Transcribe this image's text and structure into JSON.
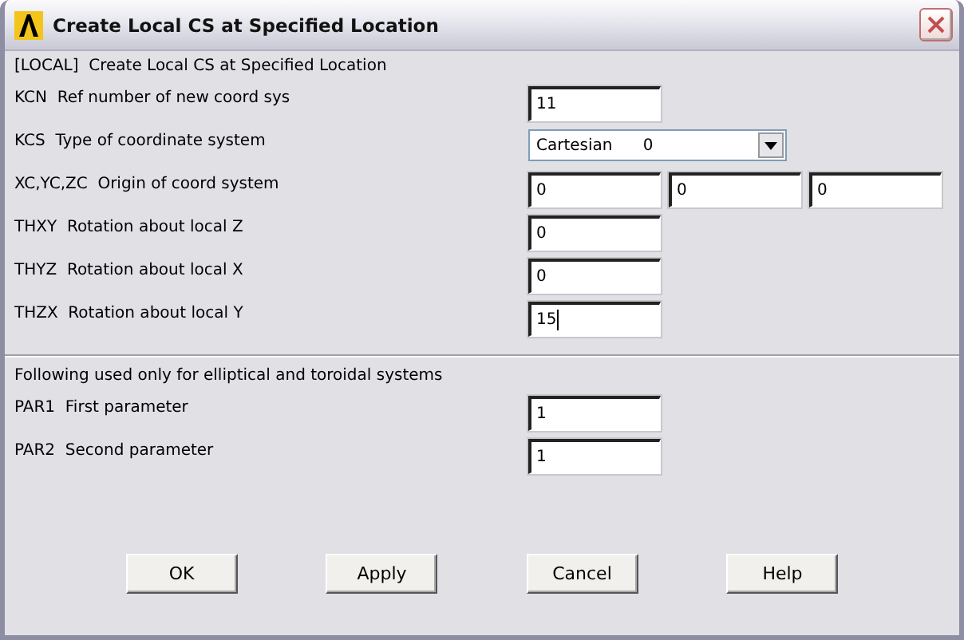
{
  "window": {
    "title": "Create Local CS at Specified Location"
  },
  "sections": [
    {
      "heading": "[LOCAL]  Create Local CS at Specified Location",
      "rows": [
        {
          "kind": "text",
          "label": "KCN  Ref number of new coord sys",
          "values": [
            "11"
          ],
          "focused": false
        },
        {
          "kind": "select",
          "label": "KCS  Type of coordinate system",
          "values": [
            "Cartesian      0"
          ]
        },
        {
          "kind": "text",
          "label": "XC,YC,ZC  Origin of coord system",
          "values": [
            "0",
            "0",
            "0"
          ],
          "focused": false
        },
        {
          "kind": "text",
          "label": "THXY  Rotation about local Z",
          "values": [
            "0"
          ],
          "focused": false
        },
        {
          "kind": "text",
          "label": "THYZ  Rotation about local X",
          "values": [
            "0"
          ],
          "focused": false
        },
        {
          "kind": "text",
          "label": "THZX  Rotation about local Y",
          "values": [
            "15"
          ],
          "focused": true
        }
      ]
    },
    {
      "heading": "Following used only for elliptical and toroidal systems",
      "rows": [
        {
          "kind": "text",
          "label": "PAR1  First parameter",
          "values": [
            "1"
          ],
          "focused": false
        },
        {
          "kind": "text",
          "label": "PAR2  Second parameter",
          "values": [
            "1"
          ],
          "focused": false
        }
      ]
    }
  ],
  "buttons": [
    "OK",
    "Apply",
    "Cancel",
    "Help"
  ]
}
